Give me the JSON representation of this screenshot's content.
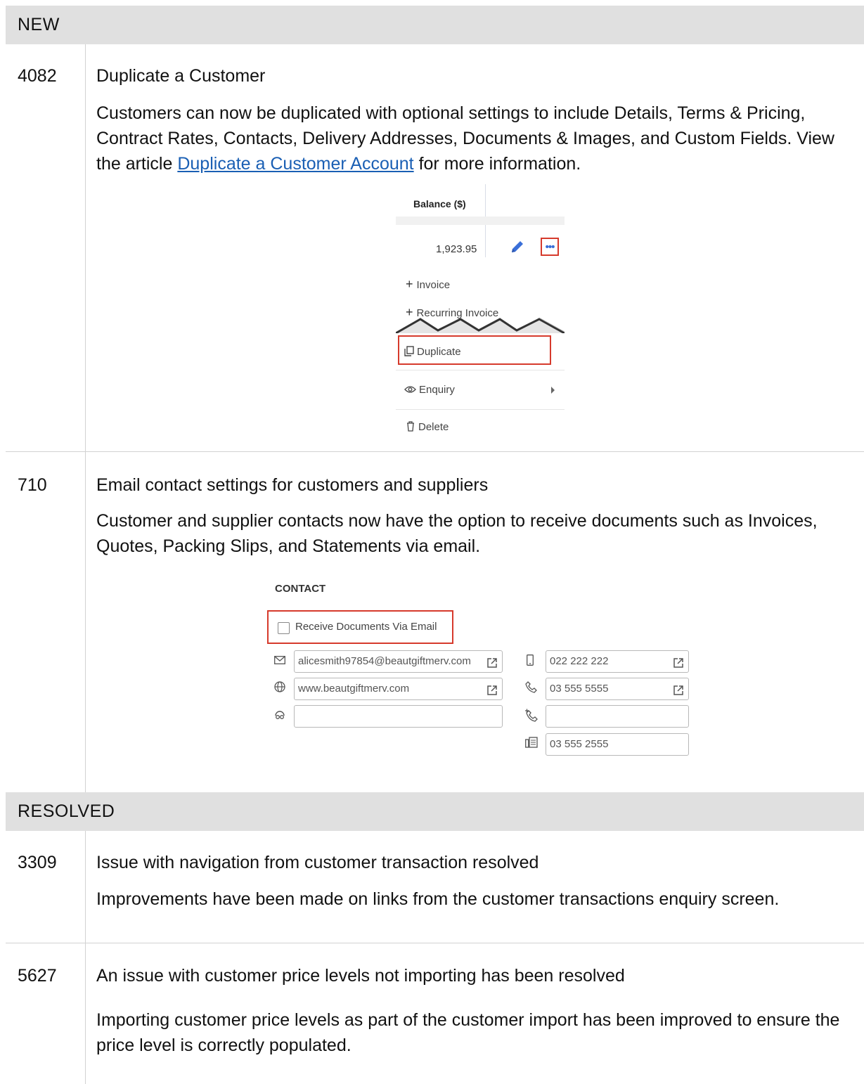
{
  "sections": {
    "new": {
      "label": "NEW"
    },
    "resolved": {
      "label": "RESOLVED"
    }
  },
  "items": {
    "i4082": {
      "id": "4082",
      "title": "Duplicate a Customer",
      "desc_part1": "Customers can now be duplicated with optional settings to include Details, Terms & Pricing, Contract Rates, Contacts, Delivery Addresses, Documents & Images, and Custom Fields. View the article ",
      "link": "Duplicate a Customer Account",
      "desc_part2": " for more information."
    },
    "i710": {
      "id": "710",
      "title": "Email contact settings for customers and suppliers",
      "desc": "Customer and supplier contacts now have the option to receive documents such as Invoices, Quotes, Packing Slips, and Statements via email."
    },
    "i3309": {
      "id": "3309",
      "title": "Issue with navigation from customer transaction resolved",
      "desc": "Improvements have been made on links from the customer transactions enquiry screen."
    },
    "i5627": {
      "id": "5627",
      "title": "An issue with customer price levels not importing has been resolved",
      "desc": "Importing customer price levels as part of the customer import has been improved to ensure the price level is correctly populated."
    }
  },
  "shot_customer_menu": {
    "column_header": "Balance ($)",
    "balance": "1,923.95",
    "more_glyph": "•••",
    "menu": {
      "invoice": "Invoice",
      "recurring_invoice": "Recurring Invoice",
      "duplicate": "Duplicate",
      "enquiry": "Enquiry",
      "delete": "Delete"
    }
  },
  "shot_contact": {
    "title": "CONTACT",
    "checkbox_label": "Receive Documents Via Email",
    "email": "alicesmith97854@beautgiftmerv.com",
    "website": "www.beautgiftmerv.com",
    "skype": "",
    "mobile": "022 222 222",
    "phone": "03 555 5555",
    "ddi": "",
    "fax": "03 555 2555"
  },
  "colors": {
    "highlight": "#d63a2c",
    "link": "#1a5fb4",
    "section_bg": "#e0e0e0"
  }
}
